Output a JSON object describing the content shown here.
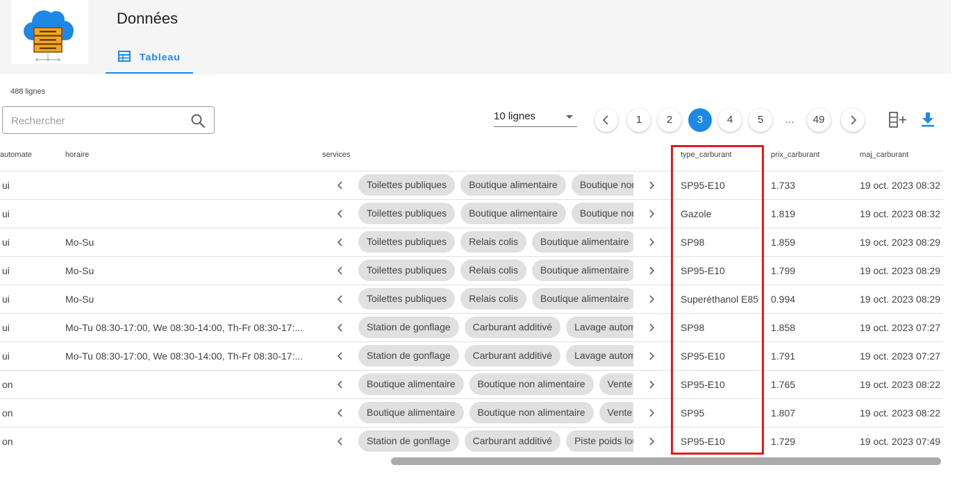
{
  "header": {
    "title": "Données",
    "tab_label": "Tableau"
  },
  "row_count": "488 lignes",
  "search": {
    "placeholder": "Rechercher",
    "value": ""
  },
  "rows_per_page": "10 lignes",
  "pagination": {
    "pages": [
      "1",
      "2",
      "3",
      "4",
      "5",
      "49"
    ],
    "current": "3",
    "ellipsis": "..."
  },
  "columns": {
    "automate": "automate",
    "horaire": "horaire",
    "services": "services",
    "type_carburant": "type_carburant",
    "prix_carburant": "prix_carburant",
    "maj_carburant": "maj_carburant"
  },
  "rows": [
    {
      "automate": "ui",
      "horaire": "",
      "services": [
        "Toilettes publiques",
        "Boutique alimentaire",
        "Boutique non alimentaire"
      ],
      "type_carburant": "SP95-E10",
      "prix_carburant": "1.733",
      "maj_carburant": "19 oct. 2023 08:32"
    },
    {
      "automate": "ui",
      "horaire": "",
      "services": [
        "Toilettes publiques",
        "Boutique alimentaire",
        "Boutique non alimentaire"
      ],
      "type_carburant": "Gazole",
      "prix_carburant": "1.819",
      "maj_carburant": "19 oct. 2023 08:32"
    },
    {
      "automate": "ui",
      "horaire": "Mo-Su",
      "services": [
        "Toilettes publiques",
        "Relais colis",
        "Boutique alimentaire"
      ],
      "type_carburant": "SP98",
      "prix_carburant": "1.859",
      "maj_carburant": "19 oct. 2023 08:29"
    },
    {
      "automate": "ui",
      "horaire": "Mo-Su",
      "services": [
        "Toilettes publiques",
        "Relais colis",
        "Boutique alimentaire"
      ],
      "type_carburant": "SP95-E10",
      "prix_carburant": "1.799",
      "maj_carburant": "19 oct. 2023 08:29"
    },
    {
      "automate": "ui",
      "horaire": "Mo-Su",
      "services": [
        "Toilettes publiques",
        "Relais colis",
        "Boutique alimentaire"
      ],
      "type_carburant": "Superéthanol E85",
      "prix_carburant": "0.994",
      "maj_carburant": "19 oct. 2023 08:29"
    },
    {
      "automate": "ui",
      "horaire": "Mo-Tu 08:30-17:00, We 08:30-14:00, Th-Fr 08:30-17:...",
      "services": [
        "Station de gonflage",
        "Carburant additivé",
        "Lavage automatique"
      ],
      "type_carburant": "SP98",
      "prix_carburant": "1.858",
      "maj_carburant": "19 oct. 2023 07:27"
    },
    {
      "automate": "ui",
      "horaire": "Mo-Tu 08:30-17:00, We 08:30-14:00, Th-Fr 08:30-17:...",
      "services": [
        "Station de gonflage",
        "Carburant additivé",
        "Lavage automatique"
      ],
      "type_carburant": "SP95-E10",
      "prix_carburant": "1.791",
      "maj_carburant": "19 oct. 2023 07:27"
    },
    {
      "automate": "on",
      "horaire": "",
      "services": [
        "Boutique alimentaire",
        "Boutique non alimentaire",
        "Vente"
      ],
      "type_carburant": "SP95-E10",
      "prix_carburant": "1.765",
      "maj_carburant": "19 oct. 2023 08:22"
    },
    {
      "automate": "on",
      "horaire": "",
      "services": [
        "Boutique alimentaire",
        "Boutique non alimentaire",
        "Vente"
      ],
      "type_carburant": "SP95",
      "prix_carburant": "1.807",
      "maj_carburant": "19 oct. 2023 08:22"
    },
    {
      "automate": "on",
      "horaire": "",
      "services": [
        "Station de gonflage",
        "Carburant additivé",
        "Piste poids lourds"
      ],
      "type_carburant": "SP95-E10",
      "prix_carburant": "1.729",
      "maj_carburant": "19 oct. 2023 07:49"
    }
  ],
  "colors": {
    "accent": "#1e88e5",
    "highlight": "#e01b1b",
    "chip": "#e0e0e0",
    "logo_cloud": "#1e88e5",
    "logo_server": "#f5a623"
  },
  "icons": {
    "search": "search-icon",
    "table": "table-icon",
    "add_column": "add-column-icon",
    "download": "download-icon"
  }
}
